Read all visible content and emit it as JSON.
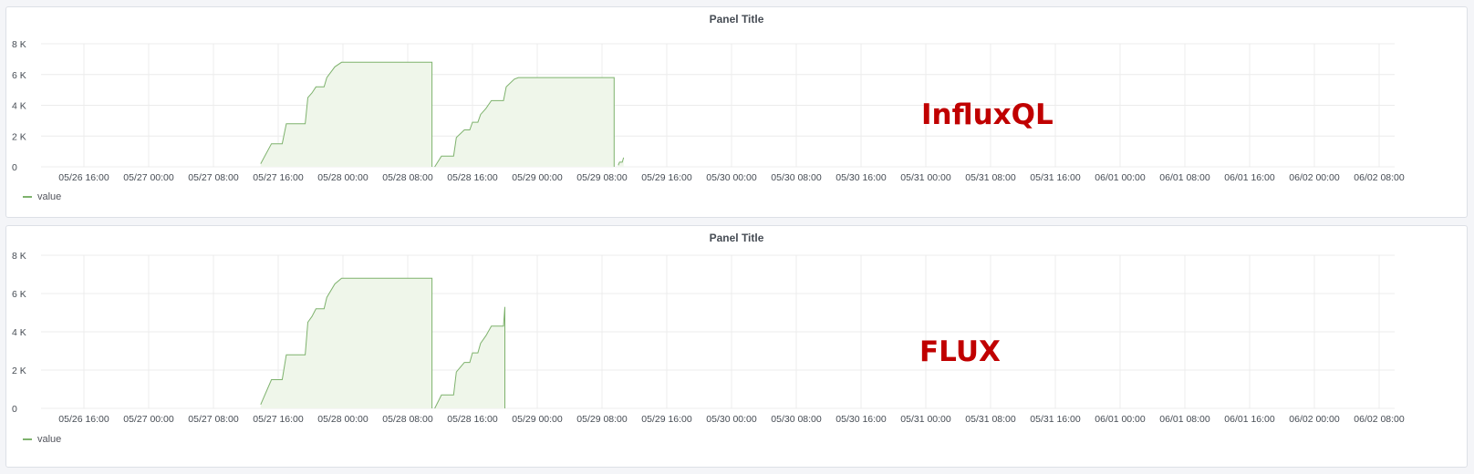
{
  "colors": {
    "series": "#7eb26d",
    "fill": "#eff6ea",
    "grid": "#ececec",
    "annotation": "#c00000"
  },
  "chart_data": [
    {
      "type": "area",
      "title": "Panel Title",
      "annotation": "InfluxQL",
      "x_tick_labels": [
        "05/26 16:00",
        "05/27 00:00",
        "05/27 08:00",
        "05/27 16:00",
        "05/28 00:00",
        "05/28 08:00",
        "05/28 16:00",
        "05/29 00:00",
        "05/29 08:00",
        "05/29 16:00",
        "05/30 00:00",
        "05/30 08:00",
        "05/30 16:00",
        "05/31 00:00",
        "05/31 08:00",
        "05/31 16:00",
        "06/01 00:00",
        "06/01 08:00",
        "06/01 16:00",
        "06/02 00:00",
        "06/02 08:00"
      ],
      "y_tick_labels": [
        "0",
        "2 K",
        "4 K",
        "6 K",
        "8 K"
      ],
      "ylim": [
        0,
        8000
      ],
      "grid": true,
      "legend": {
        "entries": [
          "value"
        ],
        "placement": "bottom-left"
      },
      "series": [
        {
          "name": "value",
          "segments": [
            [
              [
                "05/27 13:50",
                200
              ],
              [
                "05/27 15:10",
                1500
              ],
              [
                "05/27 16:30",
                1500
              ],
              [
                "05/27 17:00",
                2800
              ],
              [
                "05/27 19:20",
                2800
              ],
              [
                "05/27 19:40",
                4500
              ],
              [
                "05/27 20:10",
                4800
              ],
              [
                "05/27 20:40",
                5200
              ],
              [
                "05/27 21:40",
                5200
              ],
              [
                "05/27 22:00",
                5800
              ],
              [
                "05/27 23:00",
                6500
              ],
              [
                "05/27 23:50",
                6800
              ],
              [
                "05/28 11:00",
                6800
              ],
              [
                "05/28 11:00",
                0
              ]
            ],
            [
              [
                "05/28 11:20",
                0
              ],
              [
                "05/28 12:10",
                700
              ],
              [
                "05/28 13:40",
                700
              ],
              [
                "05/28 14:00",
                1900
              ],
              [
                "05/28 15:00",
                2400
              ],
              [
                "05/28 15:40",
                2400
              ],
              [
                "05/28 16:00",
                2900
              ],
              [
                "05/28 16:40",
                2900
              ],
              [
                "05/28 17:00",
                3400
              ],
              [
                "05/28 17:40",
                3800
              ],
              [
                "05/28 18:20",
                4300
              ],
              [
                "05/28 19:50",
                4300
              ],
              [
                "05/28 20:10",
                5200
              ],
              [
                "05/28 21:10",
                5700
              ],
              [
                "05/28 21:40",
                5800
              ],
              [
                "05/29 09:30",
                5800
              ],
              [
                "05/29 09:30",
                0
              ]
            ],
            [
              [
                "05/29 10:00",
                100
              ],
              [
                "05/29 10:10",
                300
              ],
              [
                "05/29 10:30",
                300
              ],
              [
                "05/29 10:40",
                600
              ]
            ]
          ]
        }
      ]
    },
    {
      "type": "area",
      "title": "Panel Title",
      "annotation": "FLUX",
      "x_tick_labels": [
        "05/26 16:00",
        "05/27 00:00",
        "05/27 08:00",
        "05/27 16:00",
        "05/28 00:00",
        "05/28 08:00",
        "05/28 16:00",
        "05/29 00:00",
        "05/29 08:00",
        "05/29 16:00",
        "05/30 00:00",
        "05/30 08:00",
        "05/30 16:00",
        "05/31 00:00",
        "05/31 08:00",
        "05/31 16:00",
        "06/01 00:00",
        "06/01 08:00",
        "06/01 16:00",
        "06/02 00:00",
        "06/02 08:00"
      ],
      "y_tick_labels": [
        "0",
        "2 K",
        "4 K",
        "6 K",
        "8 K"
      ],
      "ylim": [
        0,
        8000
      ],
      "grid": true,
      "legend": {
        "entries": [
          "value"
        ],
        "placement": "bottom-left"
      },
      "series": [
        {
          "name": "value",
          "segments": [
            [
              [
                "05/27 13:50",
                200
              ],
              [
                "05/27 15:10",
                1500
              ],
              [
                "05/27 16:30",
                1500
              ],
              [
                "05/27 17:00",
                2800
              ],
              [
                "05/27 19:20",
                2800
              ],
              [
                "05/27 19:40",
                4500
              ],
              [
                "05/27 20:10",
                4800
              ],
              [
                "05/27 20:40",
                5200
              ],
              [
                "05/27 21:40",
                5200
              ],
              [
                "05/27 22:00",
                5800
              ],
              [
                "05/27 23:00",
                6500
              ],
              [
                "05/27 23:50",
                6800
              ],
              [
                "05/28 11:00",
                6800
              ],
              [
                "05/28 11:00",
                0
              ]
            ],
            [
              [
                "05/28 11:20",
                0
              ],
              [
                "05/28 12:10",
                700
              ],
              [
                "05/28 13:40",
                700
              ],
              [
                "05/28 14:00",
                1900
              ],
              [
                "05/28 15:00",
                2400
              ],
              [
                "05/28 15:40",
                2400
              ],
              [
                "05/28 16:00",
                2900
              ],
              [
                "05/28 16:40",
                2900
              ],
              [
                "05/28 17:00",
                3400
              ],
              [
                "05/28 17:40",
                3800
              ],
              [
                "05/28 18:20",
                4300
              ],
              [
                "05/28 19:50",
                4300
              ],
              [
                "05/28 20:00",
                5300
              ],
              [
                "05/28 20:00",
                0
              ]
            ]
          ]
        }
      ]
    }
  ]
}
